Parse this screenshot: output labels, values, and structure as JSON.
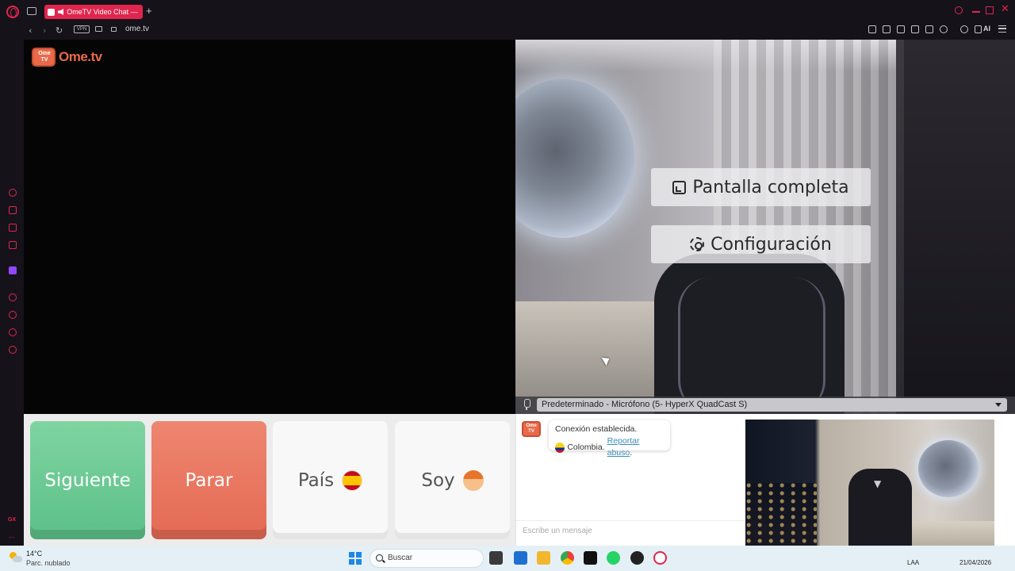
{
  "browser": {
    "tab_title": "OmeTV Video Chat — ",
    "new_tab": "+",
    "url": "ome.tv",
    "vpn_label": "VPN",
    "ai_label": "AI",
    "sidebar_gx": "GX",
    "sidebar_more": "...",
    "close_glyph": "✕"
  },
  "nav": {
    "back": "‹",
    "forward": "›",
    "reload": "↻"
  },
  "app": {
    "logo_box_text": "Ome TV",
    "logo_text": "Ome.tv",
    "local_video": {
      "fullscreen_label": "Pantalla completa",
      "settings_label": "Configuración"
    },
    "mic": {
      "selected": "Predeterminado - Micrófono (5- HyperX QuadCast S)"
    },
    "controls": {
      "next_label": "Siguiente",
      "stop_label": "Parar",
      "country_label": "País",
      "country_flag": "spain-flag-icon",
      "gender_label": "Soy",
      "gender_icon": "boy-emoji-icon"
    },
    "chat": {
      "logo_text": "Ome TV",
      "status": "Conexión establecida.",
      "country": "Colombia.",
      "report_link": "Reportar abuso",
      "report_suffix": ".",
      "input_placeholder": "Escribe un mensaje"
    }
  },
  "taskbar": {
    "temperature": "14°C",
    "condition": "Parc. nublado",
    "search_label": "Buscar",
    "language": "LAA",
    "date": "21/04/2026"
  },
  "colors": {
    "opera_accent": "#e0264d",
    "next_green": "#5cc088",
    "stop_red": "#e46a53",
    "link_blue": "#3a8fb7"
  }
}
